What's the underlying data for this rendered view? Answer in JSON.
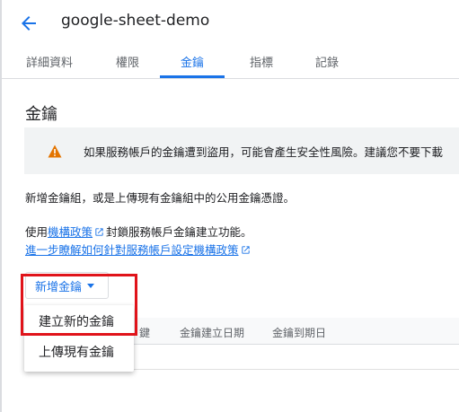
{
  "header": {
    "title": "google-sheet-demo",
    "back_icon": "arrow-back-icon"
  },
  "tabs": [
    {
      "label": "詳細資料",
      "active": false
    },
    {
      "label": "權限",
      "active": false
    },
    {
      "label": "金鑰",
      "active": true
    },
    {
      "label": "指標",
      "active": false
    },
    {
      "label": "記錄",
      "active": false
    }
  ],
  "section": {
    "title": "金鑰",
    "warning_icon": "warning-icon",
    "warning_text": "如果服務帳戶的金鑰遭到盜用，可能會產生安全性風險。建議您不要下載",
    "desc1": "新增金鑰組，或是上傳現有金鑰組中的公用金鑰憑證。",
    "desc2_prefix": "使用",
    "desc2_link": "機構政策",
    "desc2_suffix": "封鎖服務帳戶金鑰建立功能。",
    "desc3_link": "進一步瞭解如何針對服務帳戶設定機構政策"
  },
  "add_key": {
    "label": "新增金鑰",
    "menu_items": [
      "建立新的金鑰",
      "上傳現有金鑰"
    ]
  },
  "table": {
    "columns": [
      "鍵",
      "金鑰建立日期",
      "金鑰到期日"
    ]
  },
  "colors": {
    "accent": "#1a73e8",
    "warning": "#e37400",
    "highlight": "#e0131a"
  }
}
